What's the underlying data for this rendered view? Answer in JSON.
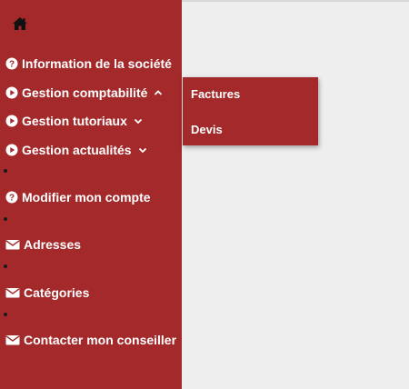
{
  "sidebar": {
    "background_color": "#a3292b",
    "home_icon": "home-icon",
    "items": [
      {
        "label": "Information de la société",
        "icon": "question-circle-icon"
      },
      {
        "label": "Gestion comptabilité",
        "icon": "play-circle-icon",
        "chevron": "chevron-up-icon",
        "expanded": true
      },
      {
        "label": "Gestion tutoriaux",
        "icon": "play-circle-icon",
        "chevron": "chevron-down-icon"
      },
      {
        "label": "Gestion actualités",
        "icon": "play-circle-icon",
        "chevron": "chevron-down-icon"
      },
      {
        "label": "Modifier mon compte",
        "icon": "question-circle-icon"
      },
      {
        "label": "Adresses",
        "icon": "envelope-icon"
      },
      {
        "label": "Catégories",
        "icon": "envelope-icon"
      },
      {
        "label": "Contacter mon conseiller",
        "icon": "envelope-icon"
      }
    ]
  },
  "submenu": {
    "parent": "Gestion comptabilité",
    "items": [
      {
        "label": "Factures"
      },
      {
        "label": "Devis"
      }
    ]
  },
  "colors": {
    "accent": "#a3292b",
    "background": "#eeeeee",
    "text": "#ffffff"
  }
}
